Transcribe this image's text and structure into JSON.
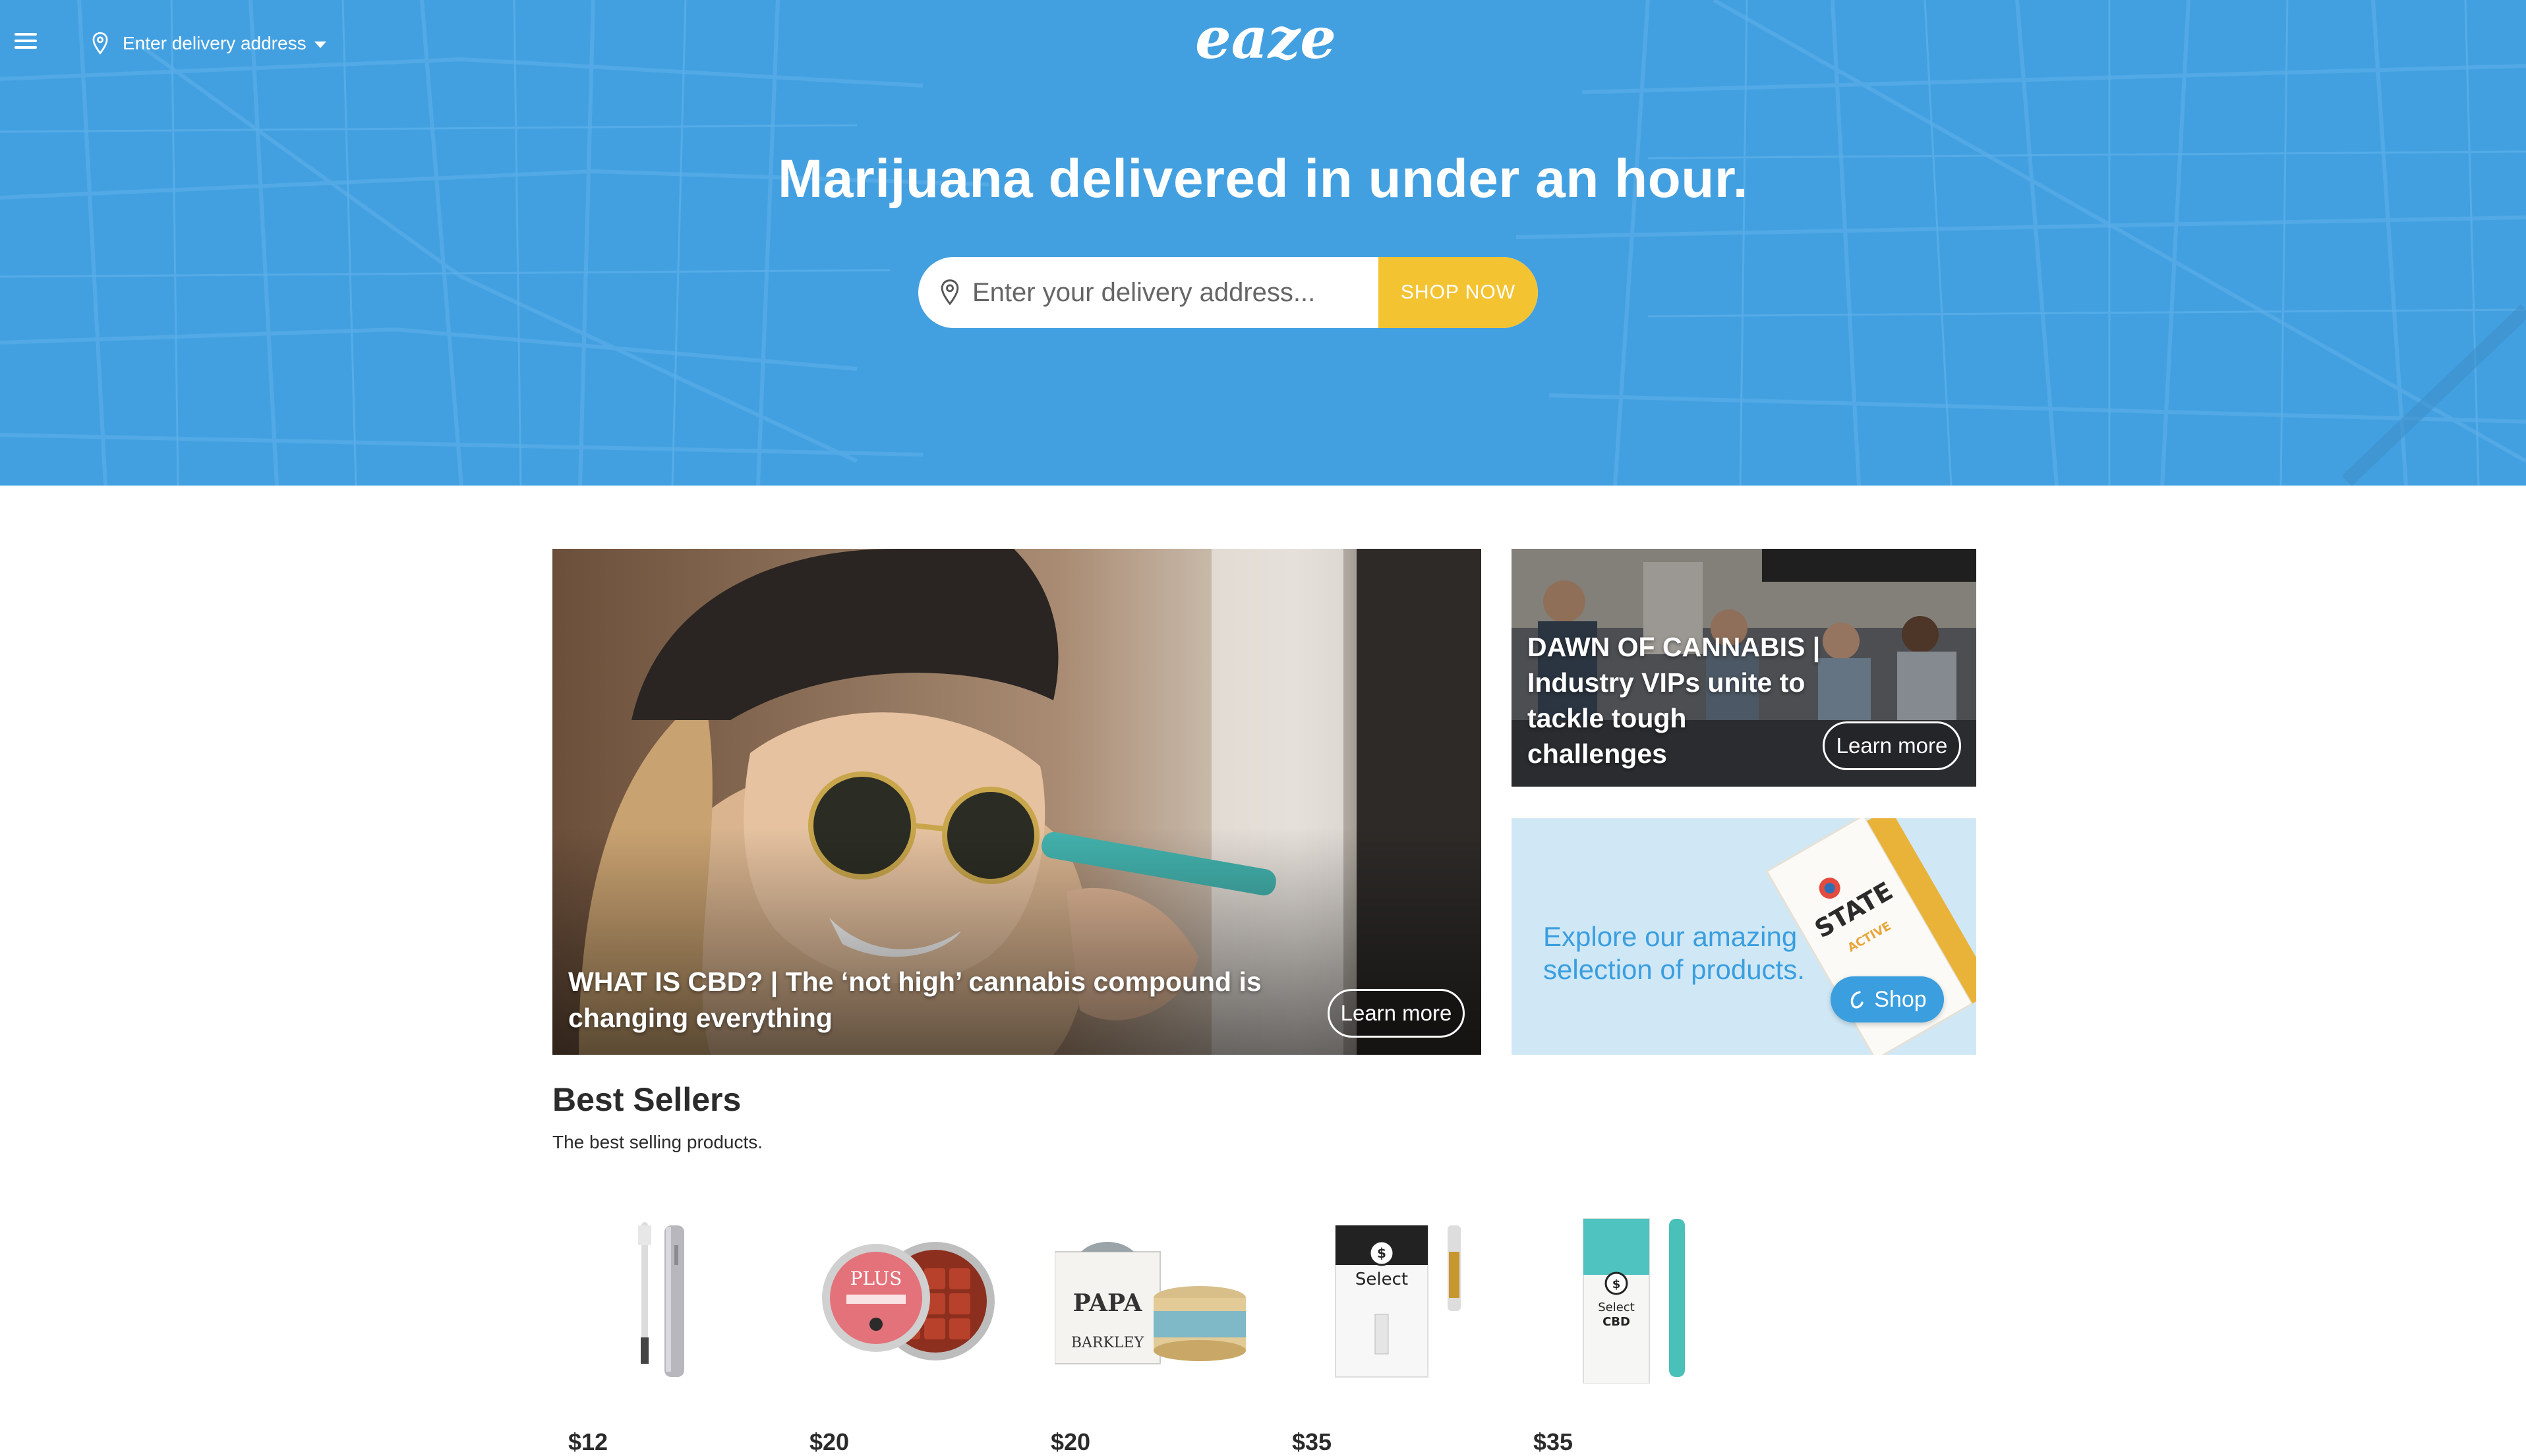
{
  "header": {
    "menu_icon": "hamburger-menu-icon",
    "delivery_address_label": "Enter delivery address",
    "logo_text": "eaze",
    "headline": "Marijuana delivered in under an hour.",
    "search_placeholder": "Enter your delivery address...",
    "shop_now_label": "SHOP NOW",
    "accent_color": "#43a0e0",
    "button_color": "#f4c332"
  },
  "promos": {
    "main": {
      "title": "WHAT IS CBD? | The ‘not high’ cannabis compound is changing everything",
      "button": "Learn more"
    },
    "secondary": {
      "title": "DAWN OF CANNABIS | Industry VIPs unite to tackle tough challenges",
      "button": "Learn more"
    },
    "shop": {
      "text": "Explore our amazing selection of products.",
      "button": "Shop"
    }
  },
  "best_sellers": {
    "title": "Best Sellers",
    "subtitle": "The best selling products.",
    "products": [
      {
        "price": "$12",
        "image": "vape-battery-product"
      },
      {
        "price": "$20",
        "image": "plus-gummies-tin-product"
      },
      {
        "price": "$20",
        "image": "papa-barkley-balm-product"
      },
      {
        "price": "$35",
        "image": "select-elite-cartridge-product"
      },
      {
        "price": "$35",
        "image": "select-cbd-pen-product"
      }
    ]
  }
}
